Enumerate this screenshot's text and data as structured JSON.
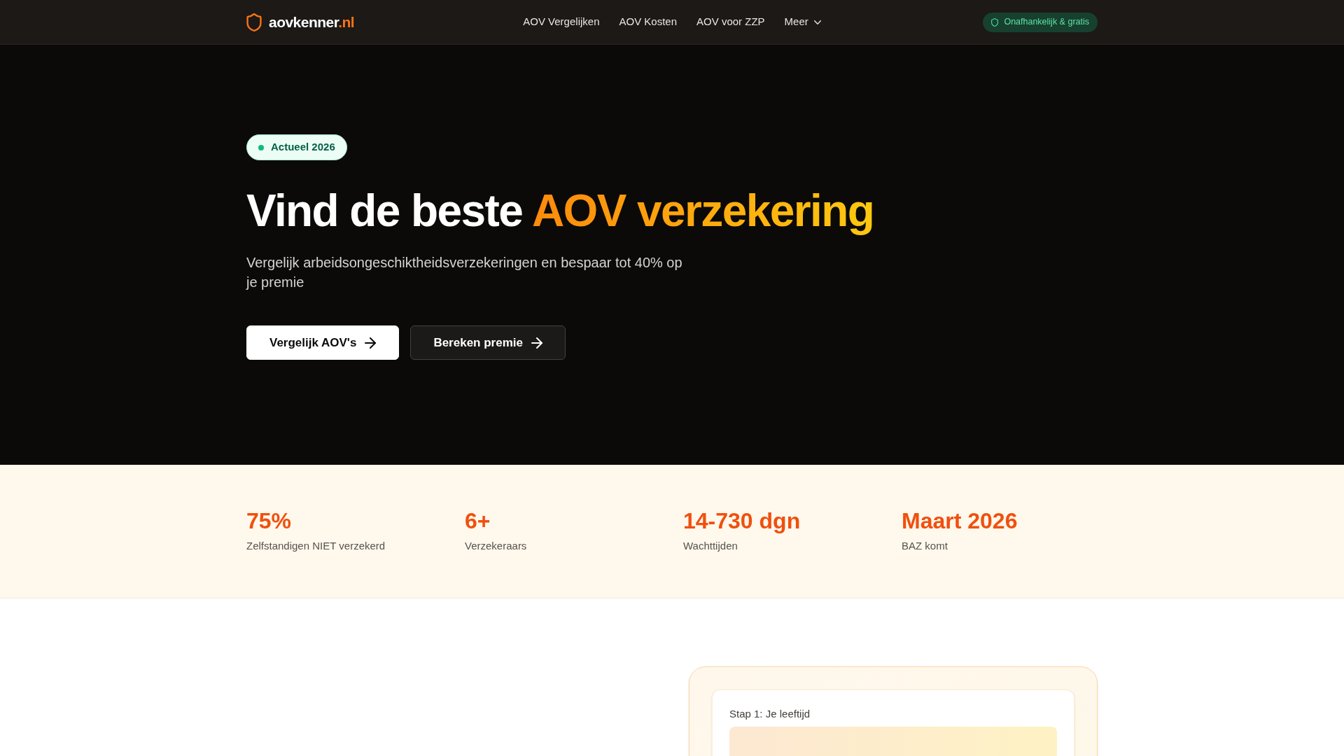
{
  "header": {
    "logo": {
      "name": "aovkenner",
      "suffix": ".nl"
    },
    "nav": [
      {
        "label": "AOV Vergelijken",
        "kind": "link"
      },
      {
        "label": "AOV Kosten",
        "kind": "link"
      },
      {
        "label": "AOV voor ZZP",
        "kind": "link"
      },
      {
        "label": "Meer",
        "kind": "dropdown"
      }
    ],
    "badge": "Onafhankelijk & gratis"
  },
  "hero": {
    "badge": "Actueel 2026",
    "heading": "Vind de beste",
    "heading_highlight": "AOV verzekering",
    "subtitle": "Vergelijk arbeidsongeschiktheidsverzekeringen en bespaar tot 40% op je premie",
    "buttons": [
      {
        "label": "Vergelijk AOV's",
        "kind": "primary"
      },
      {
        "label": "Bereken premie",
        "kind": "secondary"
      }
    ]
  },
  "stats": [
    {
      "value": "75%",
      "label": "Zelfstandigen NIET verzekerd"
    },
    {
      "value": "6+",
      "label": "Verzekeraars"
    },
    {
      "value": "14-730 dgn",
      "label": "Wachttijden"
    },
    {
      "value": "Maart 2026",
      "label": "BAZ komt"
    }
  ],
  "calculator": {
    "step_label": "Stap 1: Je leeftijd"
  }
}
